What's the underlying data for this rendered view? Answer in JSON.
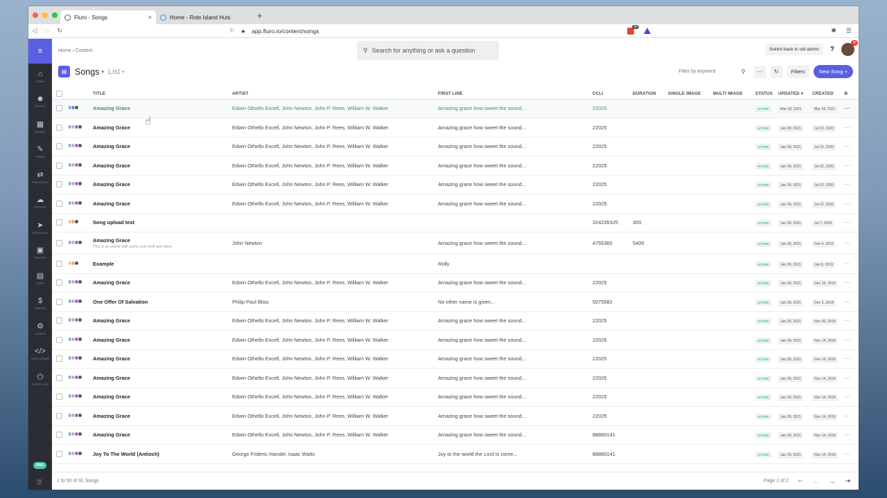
{
  "browser": {
    "tabs": [
      {
        "label": "Fluro - Songs",
        "close": "×"
      },
      {
        "label": "Home - Rote Island Huts"
      }
    ],
    "new_tab": "+",
    "url": "app.fluro.io/content/songs",
    "brave_badge": "34"
  },
  "sidebar": {
    "menu": "≡",
    "items": [
      {
        "icon": "⌂",
        "label": "HOME"
      },
      {
        "icon": "☻",
        "label": "PEOPLE"
      },
      {
        "icon": "▦",
        "label": "EVENTS"
      },
      {
        "icon": "✎",
        "label": "FORMS"
      },
      {
        "icon": "⇄",
        "label": "PROCESSES"
      },
      {
        "icon": "☁",
        "label": "CONTENT"
      },
      {
        "icon": "➤",
        "label": "MESSAGES"
      },
      {
        "icon": "▣",
        "label": "PHOTOS"
      },
      {
        "icon": "▤",
        "label": "APPS"
      },
      {
        "icon": "$",
        "label": "FINANCE"
      },
      {
        "icon": "⚙",
        "label": "CONFIG"
      },
      {
        "icon": "</>",
        "label": "DEVELOPERS"
      },
      {
        "icon": "⏻",
        "label": "SUPER USER"
      }
    ],
    "pro_badge": "PRO",
    "bottom_icon": "☰"
  },
  "header": {
    "breadcrumb": "Home › Content",
    "search_placeholder": "Search for anything or ask a question",
    "switch_label": "Switch back to old admin",
    "help": "?",
    "avatar_badge": "50"
  },
  "page": {
    "title": "Songs",
    "view": "List",
    "filter_placeholder": "Filter by keyword",
    "filters_label": "Filters",
    "new_label": "New Song"
  },
  "table": {
    "columns": [
      "TITLE",
      "ARTIST",
      "FIRST LINE",
      "CCLI",
      "DURATION",
      "SINGLE IMAGE",
      "MULTI IMAGE",
      "STATUS",
      "UPDATED",
      "CREATED"
    ],
    "rows": [
      {
        "title": "Amazing Grace",
        "artist": "Edwin Othello Excell, John Newton, John P. Rees, William W. Walker",
        "first": "Amazing grace how sweet the sound...",
        "ccli": "22025",
        "dur": "",
        "status": "ACTIVE",
        "updated": "Mar 18, 2021",
        "created": "Mar 18, 2021"
      },
      {
        "title": "Amazing Grace",
        "artist": "Edwin Othello Excell, John Newton, John P. Rees, William W. Walker",
        "first": "Amazing grace how sweet the sound...",
        "ccli": "22025",
        "dur": "",
        "status": "ACTIVE",
        "updated": "Jan 28, 2021",
        "created": "Jul 22, 2020"
      },
      {
        "title": "Amazing Grace",
        "artist": "Edwin Othello Excell, John Newton, John P. Rees, William W. Walker",
        "first": "Amazing grace how sweet the sound...",
        "ccli": "22025",
        "dur": "",
        "status": "ACTIVE",
        "updated": "Jan 28, 2021",
        "created": "Jul 22, 2020"
      },
      {
        "title": "Amazing Grace",
        "artist": "Edwin Othello Excell, John Newton, John P. Rees, William W. Walker",
        "first": "Amazing grace how sweet the sound...",
        "ccli": "22025",
        "dur": "",
        "status": "ACTIVE",
        "updated": "Jan 28, 2021",
        "created": "Jul 22, 2020"
      },
      {
        "title": "Amazing Grace",
        "artist": "Edwin Othello Excell, John Newton, John P. Rees, William W. Walker",
        "first": "Amazing grace how sweet the sound...",
        "ccli": "22025",
        "dur": "",
        "status": "ACTIVE",
        "updated": "Jan 28, 2021",
        "created": "Jul 22, 2020"
      },
      {
        "title": "Amazing Grace",
        "artist": "Edwin Othello Excell, John Newton, John P. Rees, William W. Walker",
        "first": "Amazing grace how sweet the sound...",
        "ccli": "22025",
        "dur": "",
        "status": "ACTIVE",
        "updated": "Jan 28, 2021",
        "created": "Jul 22, 2020"
      },
      {
        "title": "Song upload test",
        "artist": "",
        "first": "",
        "ccli": "324235325",
        "dur": "300",
        "status": "ACTIVE",
        "updated": "Jan 28, 2021",
        "created": "Jul 7, 2020"
      },
      {
        "title": "Amazing Grace",
        "subtitle": "This is an article with some cool stuff and other.",
        "artist": "John Newton",
        "first": "Amazing grace how sweet the sound...",
        "ccli": "4755360",
        "dur": "5400",
        "status": "ACTIVE",
        "updated": "Jan 28, 2021",
        "created": "Feb 4, 2019"
      },
      {
        "title": "Example",
        "artist": "",
        "first": "Rolly",
        "ccli": "",
        "dur": "",
        "status": "ACTIVE",
        "updated": "Jan 28, 2021",
        "created": "Jan 8, 2019"
      },
      {
        "title": "Amazing Grace",
        "artist": "Edwin Othello Excell, John Newton, John P. Rees, William W. Walker",
        "first": "Amazing grace how sweet the sound...",
        "ccli": "22025",
        "dur": "",
        "status": "ACTIVE",
        "updated": "Jan 28, 2021",
        "created": "Dec 19, 2018"
      },
      {
        "title": "One Offer Of Salvation",
        "artist": "Philip Paul Bliss",
        "first": "No other name is given...",
        "ccli": "5075582",
        "dur": "",
        "status": "ACTIVE",
        "updated": "Jan 28, 2021",
        "created": "Dec 5, 2018"
      },
      {
        "title": "Amazing Grace",
        "artist": "Edwin Othello Excell, John Newton, John P. Rees, William W. Walker",
        "first": "Amazing grace how sweet the sound...",
        "ccli": "22025",
        "dur": "",
        "status": "ACTIVE",
        "updated": "Jan 28, 2021",
        "created": "Nov 30, 2018"
      },
      {
        "title": "Amazing Grace",
        "artist": "Edwin Othello Excell, John Newton, John P. Rees, William W. Walker",
        "first": "Amazing grace how sweet the sound...",
        "ccli": "22025",
        "dur": "",
        "status": "ACTIVE",
        "updated": "Jan 28, 2021",
        "created": "Nov 14, 2018"
      },
      {
        "title": "Amazing Grace",
        "artist": "Edwin Othello Excell, John Newton, John P. Rees, William W. Walker",
        "first": "Amazing grace how sweet the sound...",
        "ccli": "22025",
        "dur": "",
        "status": "ACTIVE",
        "updated": "Jan 28, 2021",
        "created": "Nov 14, 2018"
      },
      {
        "title": "Amazing Grace",
        "artist": "Edwin Othello Excell, John Newton, John P. Rees, William W. Walker",
        "first": "Amazing grace how sweet the sound...",
        "ccli": "22025",
        "dur": "",
        "status": "ACTIVE",
        "updated": "Jan 28, 2021",
        "created": "Nov 14, 2018"
      },
      {
        "title": "Amazing Grace",
        "artist": "Edwin Othello Excell, John Newton, John P. Rees, William W. Walker",
        "first": "Amazing grace how sweet the sound...",
        "ccli": "22025",
        "dur": "",
        "status": "ACTIVE",
        "updated": "Jan 28, 2021",
        "created": "Nov 14, 2018"
      },
      {
        "title": "Amazing Grace",
        "artist": "Edwin Othello Excell, John Newton, John P. Rees, William W. Walker",
        "first": "Amazing grace how sweet the sound...",
        "ccli": "22025",
        "dur": "",
        "status": "ACTIVE",
        "updated": "Jan 28, 2021",
        "created": "Nov 14, 2018"
      },
      {
        "title": "Amazing Grace",
        "artist": "Edwin Othello Excell, John Newton, John P. Rees, William W. Walker",
        "first": "Amazing grace how sweet the sound...",
        "ccli": "88880141",
        "dur": "",
        "status": "ACTIVE",
        "updated": "Jan 28, 2021",
        "created": "Nov 14, 2018"
      },
      {
        "title": "Joy To The World (Antioch)",
        "artist": "George Frideric Handel, Isaac Watts",
        "first": "Joy to the world the Lord is come...",
        "ccli": "88880141",
        "dur": "",
        "status": "ACTIVE",
        "updated": "Jan 28, 2021",
        "created": "Nov 14, 2018"
      }
    ]
  },
  "footer": {
    "count": "1 to 50 of 91 Songs",
    "page": "Page 1 of 2"
  },
  "colors": {
    "brand": "#5a5fe0",
    "sidebar": "#2b2d35",
    "active_status": "#48b888"
  }
}
